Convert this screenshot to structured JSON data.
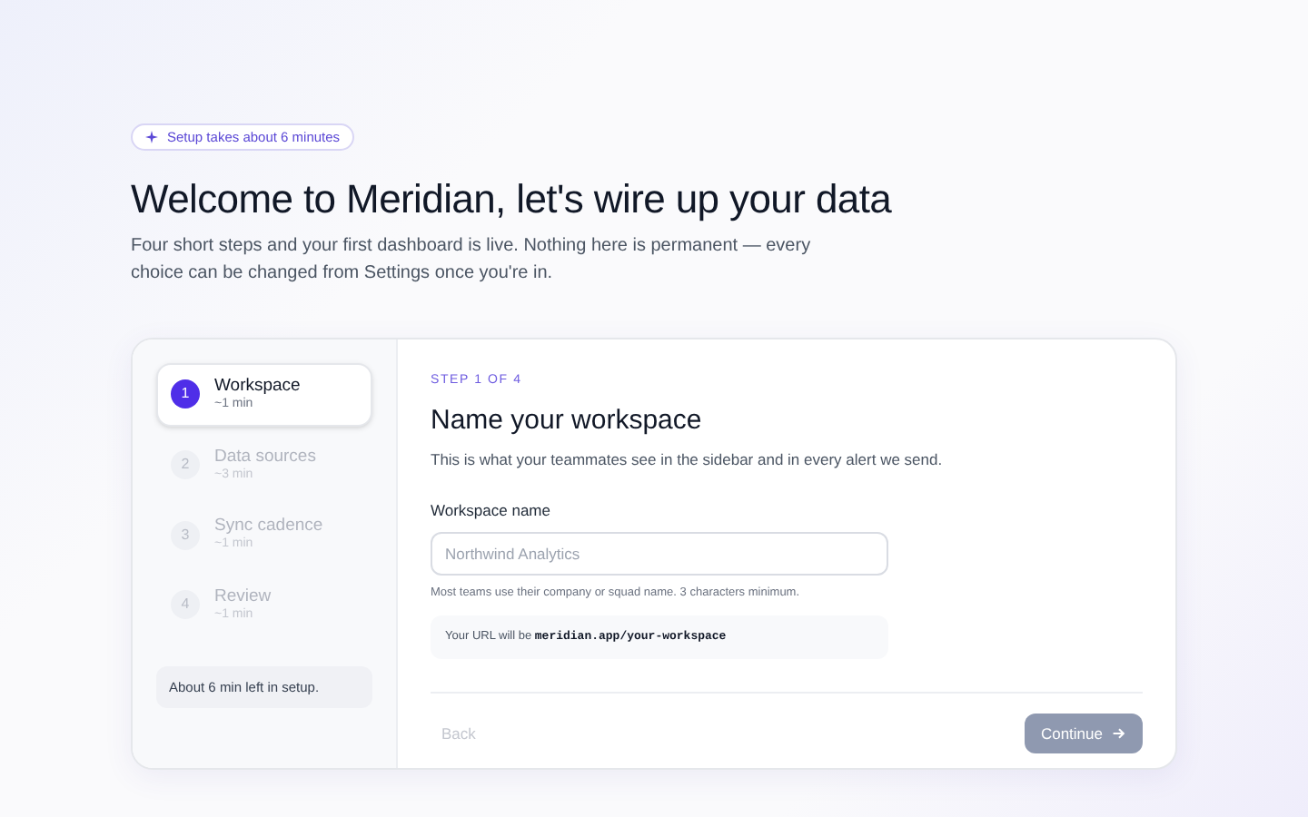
{
  "badge": {
    "text": "Setup takes about 6 minutes"
  },
  "title": "Welcome to Meridian, let's wire up your data",
  "subtitle": "Four short steps and your first dashboard is live. Nothing here is permanent — every choice can be changed from Settings once you're in.",
  "steps": [
    {
      "number": "1",
      "label": "Workspace",
      "duration": "~1 min",
      "selected": true
    },
    {
      "number": "2",
      "label": "Data sources",
      "duration": "~3 min",
      "selected": false
    },
    {
      "number": "3",
      "label": "Sync cadence",
      "duration": "~1 min",
      "selected": false
    },
    {
      "number": "4",
      "label": "Review",
      "duration": "~1 min",
      "selected": false
    }
  ],
  "time_left": "About 6 min left in setup.",
  "form": {
    "step_label": "STEP 1 OF 4",
    "heading": "Name your workspace",
    "description": "This is what your teammates see in the sidebar and in every alert we send.",
    "field_label": "Workspace name",
    "placeholder": "Northwind Analytics",
    "hint": "Most teams use their company or squad name. 3 characters minimum.",
    "url_prefix": "Your URL will be",
    "url": "meridian.app/your-workspace"
  },
  "buttons": {
    "back": {
      "label": "Back",
      "disabled": true
    },
    "continue": {
      "label": "Continue",
      "disabled": true
    }
  }
}
